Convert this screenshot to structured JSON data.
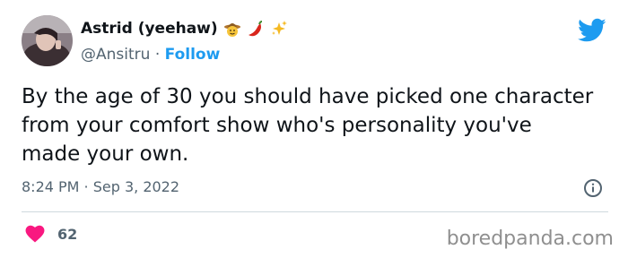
{
  "author": {
    "name": "Astrid (yeehaw)",
    "handle": "@Ansitru",
    "separator": "·",
    "follow_label": "Follow",
    "emojis": [
      "cowboy-face",
      "chili-pepper",
      "sparkles"
    ]
  },
  "tweet": {
    "text": "By the age of 30 you should have picked one character from your comfort show who's personality you've made your own.",
    "timestamp": "8:24 PM · Sep 3, 2022"
  },
  "stats": {
    "likes": "62"
  },
  "watermark": "boredpanda.com",
  "colors": {
    "accent": "#1d9bf0",
    "heart": "#f91880",
    "secondary_text": "#536471"
  }
}
